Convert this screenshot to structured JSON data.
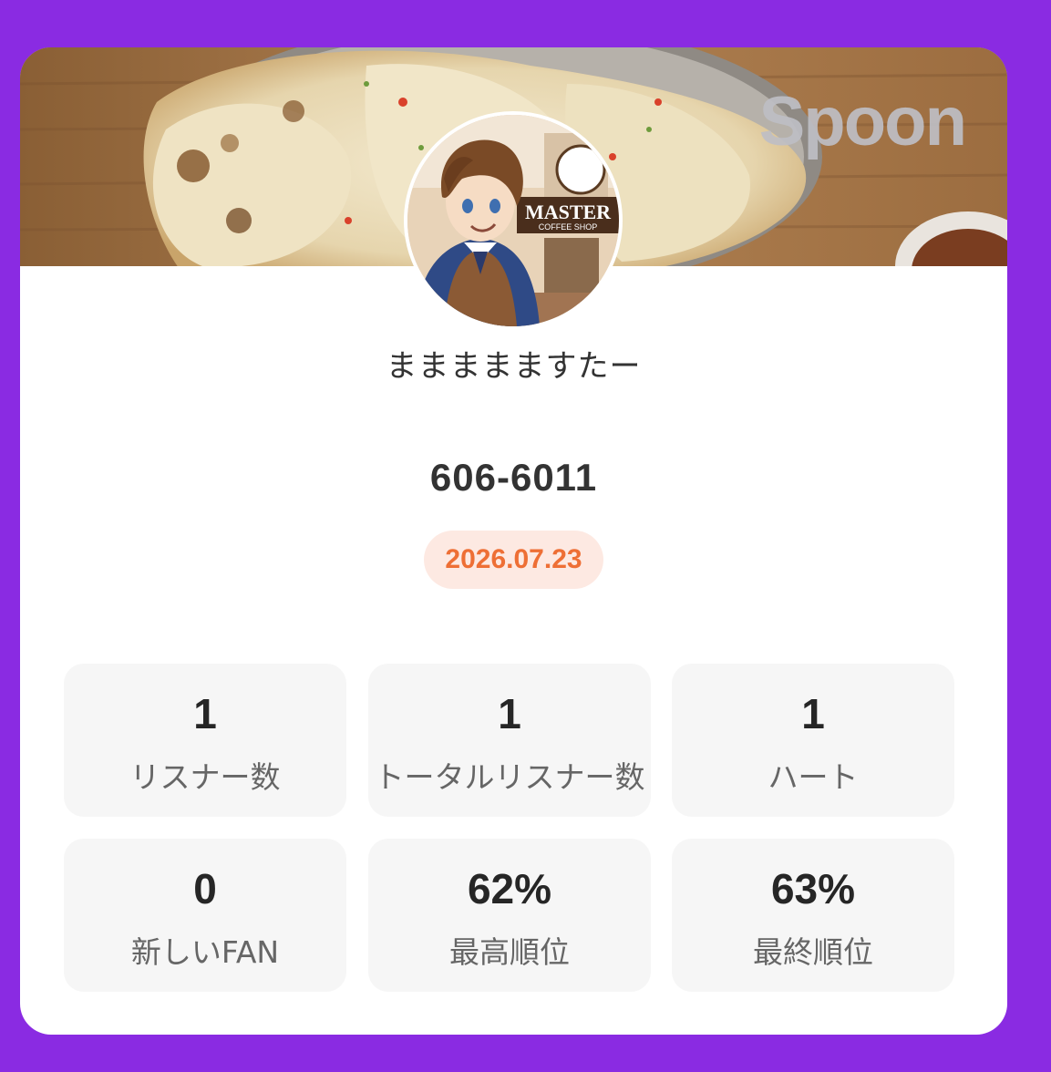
{
  "banner": {
    "brand": "Spoon"
  },
  "profile": {
    "username": "ままままますたー",
    "avatar_shop_sign": "MASTER",
    "avatar_shop_sub": "COFFEE SHOP"
  },
  "broadcast": {
    "id": "606-6011",
    "date": "2026.07.23"
  },
  "stats": [
    {
      "value": "1",
      "label": "リスナー数"
    },
    {
      "value": "1",
      "label": "トータルリスナー数"
    },
    {
      "value": "1",
      "label": "ハート"
    },
    {
      "value": "0",
      "label": "新しいFAN"
    },
    {
      "value": "62%",
      "label": "最高順位"
    },
    {
      "value": "63%",
      "label": "最終順位"
    }
  ],
  "colors": {
    "background": "#8a2be2",
    "card": "#ffffff",
    "date_badge_bg": "#fde9e2",
    "date_badge_text": "#ee6f35",
    "stat_tile": "#f6f6f6"
  }
}
